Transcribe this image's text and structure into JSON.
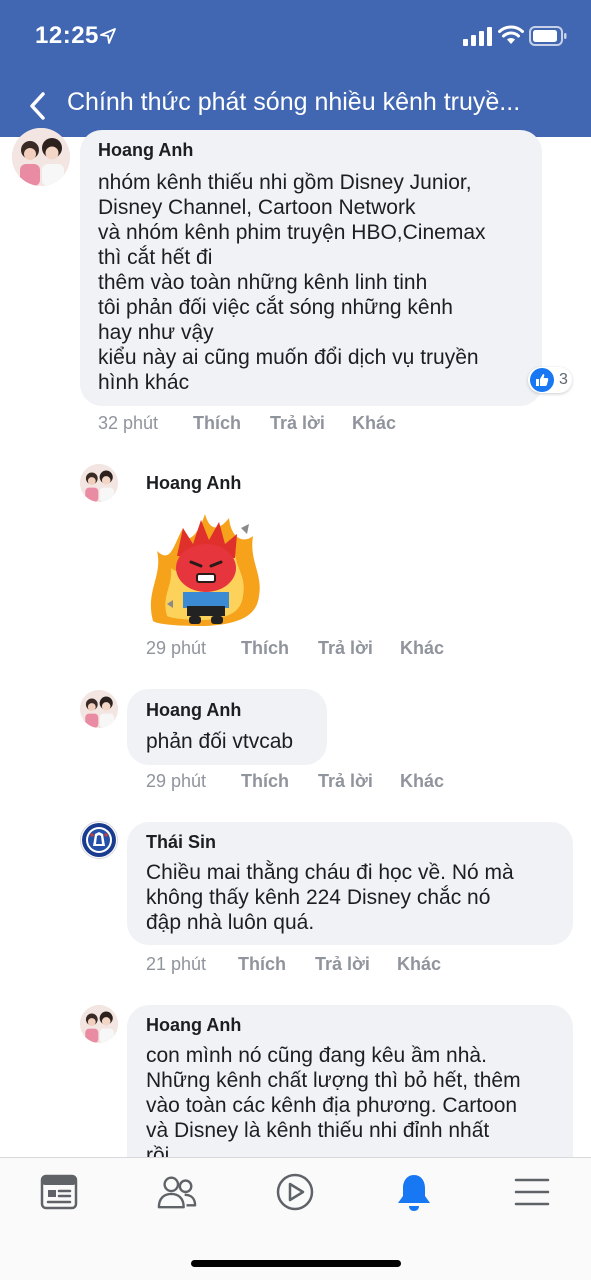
{
  "status_bar": {
    "time": "12:25"
  },
  "nav": {
    "title": "Chính thức phát sóng nhiều kênh truyề..."
  },
  "comments": [
    {
      "author": "Hoang Anh",
      "lines": [
        "nhóm kênh thiếu nhi gồm Disney Junior,",
        "Disney Channel, Cartoon Network",
        "và nhóm kênh phim truyện HBO,Cinemax",
        "thì cắt hết đi",
        "thêm vào toàn những kênh linh tinh",
        "tôi phản đối việc cắt sóng những kênh",
        "hay như vậy",
        "kiểu này ai cũng muốn đổi dịch vụ truyền",
        "hình khác"
      ],
      "time": "32 phút",
      "like": "Thích",
      "reply": "Trả lời",
      "more": "Khác",
      "reaction_count": "3"
    },
    {
      "author": "Hoang Anh",
      "sticker": "angry-boy-on-fire-sticker",
      "time": "29 phút",
      "like": "Thích",
      "reply": "Trả lời",
      "more": "Khác"
    },
    {
      "author": "Hoang Anh",
      "lines": [
        "phản đối vtvcab"
      ],
      "time": "29 phút",
      "like": "Thích",
      "reply": "Trả lời",
      "more": "Khác"
    },
    {
      "author": "Thái Sin",
      "lines": [
        "Chiều mai thằng cháu đi học về. Nó mà",
        "không thấy kênh 224 Disney chắc nó",
        "đập nhà luôn quá."
      ],
      "time": "21 phút",
      "like": "Thích",
      "reply": "Trả lời",
      "more": "Khác"
    },
    {
      "author": "Hoang Anh",
      "lines": [
        "con mình nó cũng đang kêu ầm nhà.",
        "Những kênh chất lượng thì bỏ hết, thêm",
        "vào toàn các kênh địa phương. Cartoon",
        "và Disney là kênh thiếu nhi đỉnh nhất",
        "rồi."
      ]
    }
  ],
  "tabbar": {
    "icons": [
      "news-feed-icon",
      "friends-icon",
      "watch-icon",
      "notifications-icon",
      "menu-icon"
    ],
    "active": "notifications-icon",
    "active_color": "#1877f2",
    "inactive_color": "#5f6368"
  },
  "colors": {
    "header": "#4267b2",
    "bubble": "#f0f2f5",
    "meta": "#90949c"
  }
}
